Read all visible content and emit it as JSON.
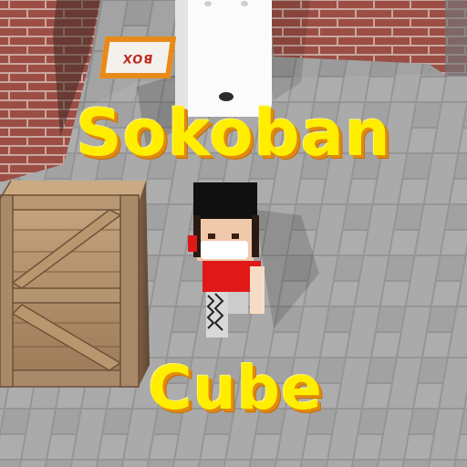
{
  "game": {
    "title_line1": "Sokoban",
    "title_line2": "Cube",
    "floor_sign_text": "BOX",
    "colors": {
      "title_fill": "#ffee00",
      "title_shadow": "#e08a10",
      "brick": "#9c4e45",
      "floor_tile": "#9a9a9a",
      "crate_wood": "#b08c66",
      "player_shirt": "#e01818"
    },
    "objects": [
      "brick-wall",
      "stone-tile-floor",
      "wooden-crate",
      "white-ghost",
      "player-character",
      "box-target-sign"
    ]
  }
}
